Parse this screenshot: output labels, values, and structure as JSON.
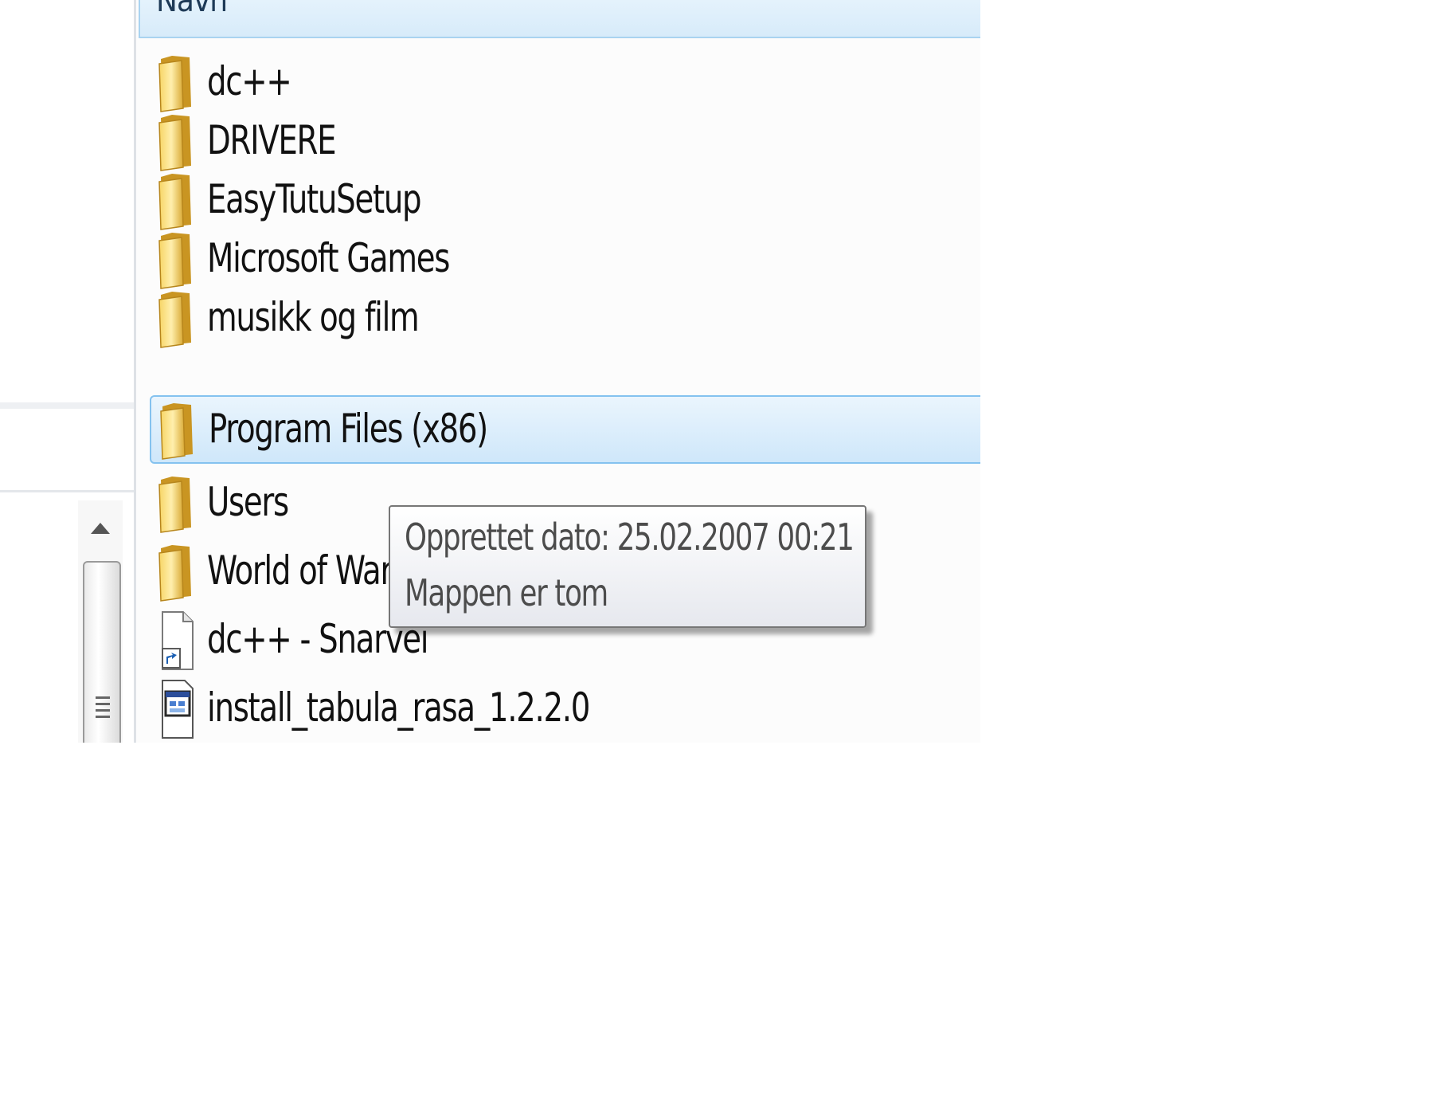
{
  "column_header": {
    "name_label": "Navn"
  },
  "files": [
    {
      "name": "dc++",
      "type": "folder",
      "selected": false
    },
    {
      "name": "DRIVERE",
      "type": "folder",
      "selected": false
    },
    {
      "name": "EasyTutuSetup",
      "type": "folder",
      "selected": false
    },
    {
      "name": "Microsoft Games",
      "type": "folder",
      "selected": false
    },
    {
      "name": "musikk og film",
      "type": "folder",
      "selected": false
    },
    {
      "name": "Program Files (x86)",
      "type": "folder",
      "selected": true
    },
    {
      "name": "Users",
      "type": "folder",
      "selected": false
    },
    {
      "name": "World of Warcraft",
      "type": "folder",
      "selected": false
    },
    {
      "name": "dc++ - Snarvei",
      "type": "shortcut",
      "selected": false
    },
    {
      "name": "install_tabula_rasa_1.2.2.0",
      "type": "installer",
      "selected": false
    }
  ],
  "tooltip": {
    "line1": "Opprettet dato: 25.02.2007 00:21",
    "line2": "Mappen er tom"
  },
  "icons": {
    "folder": "folder-icon",
    "shortcut": "shortcut-icon",
    "installer": "installer-icon",
    "chevron": "chevron-down-icon",
    "scroll_up": "scroll-up-arrow-icon",
    "grip": "scroll-grip-icon"
  },
  "colors": {
    "selection_border": "#84c2ef",
    "header_border": "#a9d3f0",
    "chevron": "#1f5fa8"
  }
}
